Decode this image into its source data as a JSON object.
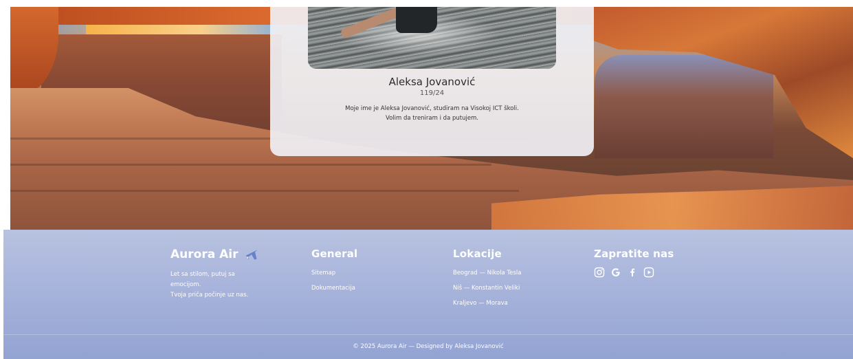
{
  "card": {
    "name": "Aleksa Jovanović",
    "index": "119/24",
    "bio_line1": "Moje ime je Aleksa Jovanović, studiram na Visokoj ICT školi.",
    "bio_line2": "Volim da treniram i da putujem."
  },
  "footer": {
    "brand": {
      "name": "Aurora Air",
      "icon": "airplane-icon",
      "tagline_line1": "Let sa stilom, putuj sa emocijom.",
      "tagline_line2": "Tvoja priča počinje uz nas."
    },
    "general": {
      "title": "General",
      "links": [
        "Sitemap",
        "Dokumentacija"
      ]
    },
    "locations": {
      "title": "Lokacije",
      "items": [
        "Beograd — Nikola Tesla",
        "Niš — Konstantin Veliki",
        "Kraljevo — Morava"
      ]
    },
    "social": {
      "title": "Zapratite nas",
      "icons": [
        "instagram-icon",
        "google-icon",
        "facebook-icon",
        "youtube-icon"
      ]
    },
    "copyright": "© 2025 Aurora Air — Designed by Aleksa Jovanović"
  },
  "colors": {
    "footer_top": "#b8c2e0",
    "footer_bottom": "#93a3d2",
    "card_bg": "#f0f0f4",
    "plane_accent": "#5b78c8"
  }
}
